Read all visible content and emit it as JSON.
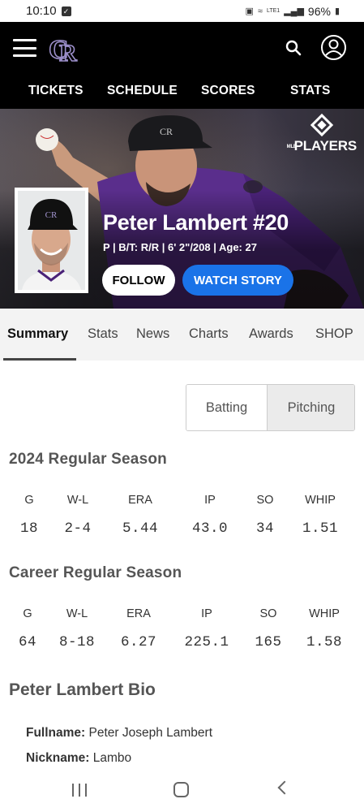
{
  "status_bar": {
    "time": "10:10",
    "battery": "96%",
    "network": "LTE1"
  },
  "header": {
    "nav": [
      "TICKETS",
      "SCHEDULE",
      "SCORES",
      "STATS"
    ]
  },
  "hero": {
    "brand": "PLAYERS",
    "brand_prefix": "MLB",
    "name": "Peter Lambert #20",
    "meta": "P | B/T: R/R | 6' 2\"/208 | Age: 27",
    "follow_label": "FOLLOW",
    "watch_label": "WATCH STORY"
  },
  "tabs": [
    "Summary",
    "Stats",
    "News",
    "Charts",
    "Awards",
    "SHOP"
  ],
  "toggle": {
    "batting": "Batting",
    "pitching": "Pitching"
  },
  "season": {
    "title": "2024 Regular Season",
    "headers": [
      "G",
      "W-L",
      "ERA",
      "IP",
      "SO",
      "WHIP"
    ],
    "values": [
      "18",
      "2-4",
      "5.44",
      "43.0",
      "34",
      "1.51"
    ]
  },
  "career": {
    "title": "Career Regular Season",
    "headers": [
      "G",
      "W-L",
      "ERA",
      "IP",
      "SO",
      "WHIP"
    ],
    "values": [
      "64",
      "8-18",
      "6.27",
      "225.1",
      "165",
      "1.58"
    ]
  },
  "bio": {
    "title": "Peter Lambert Bio",
    "fullname_label": "Fullname:",
    "fullname": "Peter Joseph Lambert",
    "nickname_label": "Nickname:",
    "nickname": "Lambo"
  },
  "colors": {
    "accent_blue": "#1a73e8",
    "rockies_purple": "#33006f"
  }
}
